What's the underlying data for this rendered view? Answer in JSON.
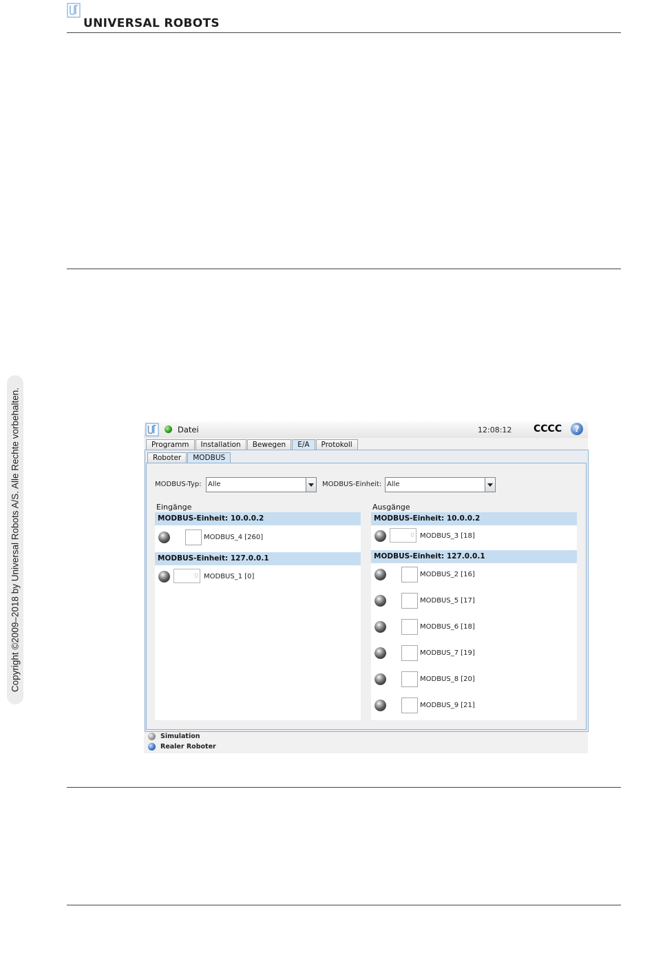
{
  "page": {
    "brand_name": "UNIVERSAL ROBOTS",
    "copyright": "Copyright ©2009–2018 by Universal Robots A/S. Alle Rechte vorbehalten."
  },
  "app": {
    "menu_label": "Datei",
    "clock": "12:08:12",
    "robot_name": "CCCC",
    "help_glyph": "?",
    "tabs": [
      {
        "label": "Programm",
        "active": false
      },
      {
        "label": "Installation",
        "active": false
      },
      {
        "label": "Bewegen",
        "active": false
      },
      {
        "label": "E/A",
        "active": true
      },
      {
        "label": "Protokoll",
        "active": false
      }
    ],
    "subtabs": [
      {
        "label": "Roboter",
        "active": false
      },
      {
        "label": "MODBUS",
        "active": true
      }
    ],
    "filters": {
      "type_label": "MODBUS-Typ:",
      "type_value": "Alle",
      "unit_label": "MODBUS-Einheit:",
      "unit_value": "Alle"
    },
    "inputs": {
      "title": "Eingänge",
      "groups": [
        {
          "header": "MODBUS-Einheit: 10.0.0.2",
          "signals": [
            {
              "name": "MODBUS_4 [260]",
              "kind": "box"
            }
          ]
        },
        {
          "header": "MODBUS-Einheit: 127.0.0.1",
          "signals": [
            {
              "name": "MODBUS_1 [0]",
              "kind": "register",
              "value": "0"
            }
          ]
        }
      ]
    },
    "outputs": {
      "title": "Ausgänge",
      "groups": [
        {
          "header": "MODBUS-Einheit: 10.0.0.2",
          "signals": [
            {
              "name": "MODBUS_3 [18]",
              "kind": "register",
              "value": "0"
            }
          ]
        },
        {
          "header": "MODBUS-Einheit: 127.0.0.1",
          "signals": [
            {
              "name": "MODBUS_2 [16]",
              "kind": "box"
            },
            {
              "name": "MODBUS_5 [17]",
              "kind": "box"
            },
            {
              "name": "MODBUS_6 [18]",
              "kind": "box"
            },
            {
              "name": "MODBUS_7 [19]",
              "kind": "box"
            },
            {
              "name": "MODBUS_8 [20]",
              "kind": "box"
            },
            {
              "name": "MODBUS_9 [21]",
              "kind": "box"
            }
          ]
        }
      ]
    },
    "modes": {
      "simulation": "Simulation",
      "real": "Realer Roboter"
    },
    "colors": {
      "accent_header": "#c6ddf1",
      "frame_border": "#8fb3d5",
      "status_green": "#2f9a1e"
    }
  }
}
